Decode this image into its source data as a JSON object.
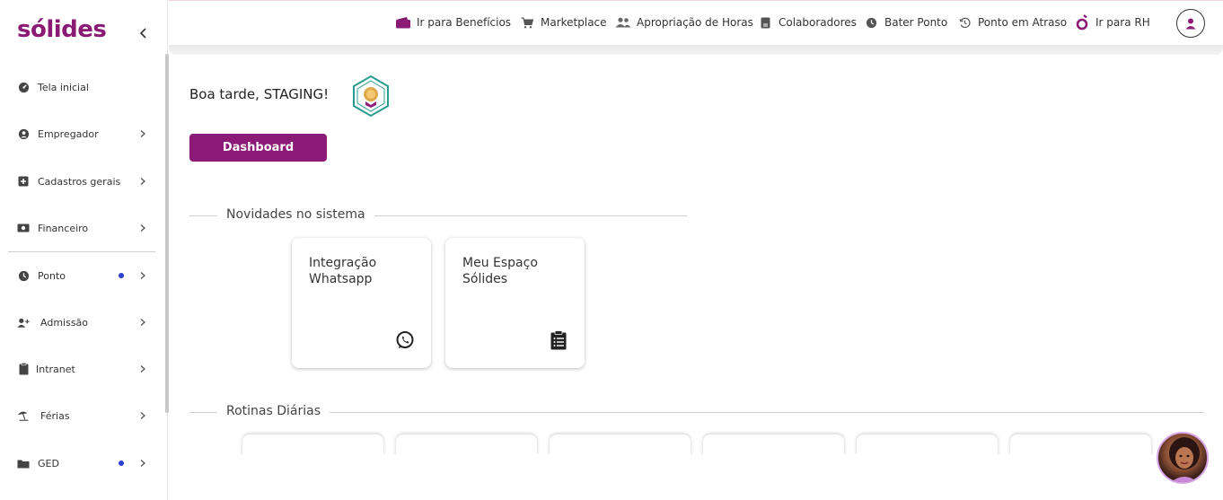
{
  "brand": {
    "logo_text": "sólides",
    "color": "#8a1a73"
  },
  "sidebar": {
    "items": [
      {
        "label": "Tela inicial",
        "icon": "dashboard-icon",
        "has_chevron": false,
        "has_dot": false
      },
      {
        "label": "Empregador",
        "icon": "user-circle-icon",
        "has_chevron": true,
        "has_dot": false
      },
      {
        "label": "Cadastros gerais",
        "icon": "plus-square-icon",
        "has_chevron": true,
        "has_dot": false
      },
      {
        "label": "Financeiro",
        "icon": "money-icon",
        "has_chevron": true,
        "has_dot": false
      },
      {
        "label": "Ponto",
        "icon": "clock-icon",
        "has_chevron": true,
        "has_dot": true
      },
      {
        "label": "Admissão",
        "icon": "user-plus-icon",
        "has_chevron": true,
        "has_dot": false
      },
      {
        "label": "Intranet",
        "icon": "clipboard-icon",
        "has_chevron": true,
        "has_dot": false
      },
      {
        "label": "Férias",
        "icon": "beach-umbrella-icon",
        "has_chevron": true,
        "has_dot": false
      },
      {
        "label": "GED",
        "icon": "folder-icon",
        "has_chevron": true,
        "has_dot": true
      }
    ]
  },
  "topbar": {
    "items": [
      {
        "label": "Ir para Benefícios",
        "icon": "wallet-icon"
      },
      {
        "label": "Marketplace",
        "icon": "cart-icon"
      },
      {
        "label": "Apropriação de Horas",
        "icon": "users-icon"
      },
      {
        "label": "Colaboradores",
        "icon": "id-card-icon"
      },
      {
        "label": "Bater Ponto",
        "icon": "clock-icon"
      },
      {
        "label": "Ponto em Atraso",
        "icon": "history-icon"
      },
      {
        "label": "Ir para RH",
        "icon": "solides-logo-icon"
      }
    ]
  },
  "main": {
    "greeting": "Boa tarde, STAGING!",
    "dashboard_button": "Dashboard",
    "news_section_title": "Novidades no sistema",
    "news_cards": [
      {
        "title": "Integração Whatsapp",
        "icon": "whatsapp-icon"
      },
      {
        "title": "Meu Espaço Sólides",
        "icon": "clipboard-list-icon"
      }
    ],
    "routines_section_title": "Rotinas Diárias"
  },
  "colors": {
    "primary": "#8b1b76",
    "dot": "#2b3fd1",
    "badge_green": "#2a9d8f",
    "badge_gold": "#e0a84a"
  }
}
